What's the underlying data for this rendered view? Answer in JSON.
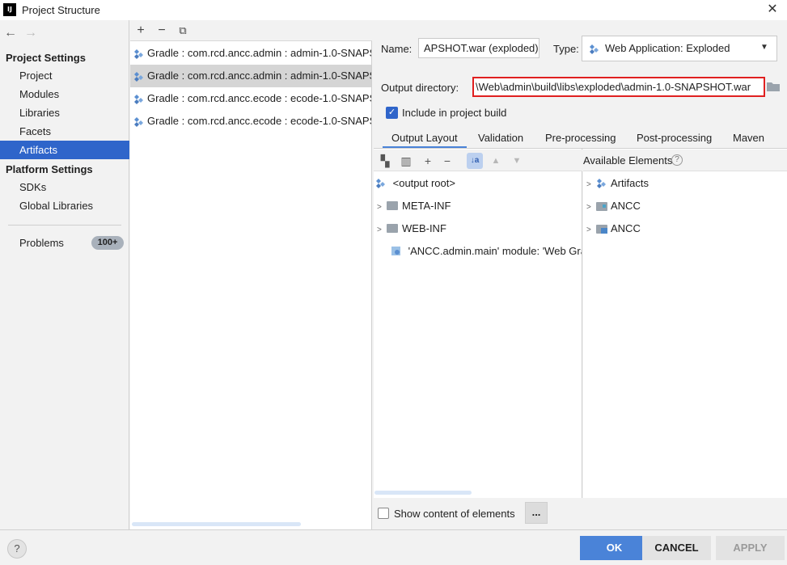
{
  "window": {
    "title": "Project Structure",
    "app_icon_text": "IJ"
  },
  "sidebar": {
    "project_settings_heading": "Project Settings",
    "project_items": [
      {
        "label": "Project"
      },
      {
        "label": "Modules"
      },
      {
        "label": "Libraries"
      },
      {
        "label": "Facets"
      },
      {
        "label": "Artifacts",
        "selected": true
      }
    ],
    "platform_settings_heading": "Platform Settings",
    "platform_items": [
      {
        "label": "SDKs"
      },
      {
        "label": "Global Libraries"
      }
    ],
    "problems_label": "Problems",
    "problems_count": "100+"
  },
  "artifacts": [
    {
      "label": "Gradle : com.rcd.ancc.admin : admin-1.0-SNAPS"
    },
    {
      "label": "Gradle : com.rcd.ancc.admin : admin-1.0-SNAPS",
      "selected": true
    },
    {
      "label": "Gradle : com.rcd.ancc.ecode : ecode-1.0-SNAPS"
    },
    {
      "label": "Gradle : com.rcd.ancc.ecode : ecode-1.0-SNAPS"
    }
  ],
  "details": {
    "name_label": "Name:",
    "name_value": "APSHOT.war (exploded)",
    "type_label": "Type:",
    "type_value": "Web Application: Exploded",
    "output_dir_label": "Output directory:",
    "output_dir_value": "\\Web\\admin\\build\\libs\\exploded\\admin-1.0-SNAPSHOT.war",
    "include_label": "Include in project build",
    "include_checked": true
  },
  "tabs": [
    {
      "label": "Output Layout",
      "selected": true
    },
    {
      "label": "Validation"
    },
    {
      "label": "Pre-processing"
    },
    {
      "label": "Post-processing"
    },
    {
      "label": "Maven"
    }
  ],
  "layout_tree": {
    "root": "<output root>",
    "items": [
      {
        "label": "META-INF"
      },
      {
        "label": "WEB-INF"
      },
      {
        "label": "'ANCC.admin.main' module: 'Web Gra"
      }
    ]
  },
  "available": {
    "heading": "Available Elements",
    "items": [
      {
        "label": "Artifacts"
      },
      {
        "label": "ANCC"
      },
      {
        "label": "ANCC"
      }
    ]
  },
  "show_content_label": "Show content of elements",
  "more_label": "...",
  "buttons": {
    "ok": "OK",
    "cancel": "CANCEL",
    "apply": "APPLY",
    "help": "?"
  },
  "colors": {
    "accent": "#2f65ca",
    "highlight_border": "#e02020",
    "ok_button": "#4a83d8"
  }
}
